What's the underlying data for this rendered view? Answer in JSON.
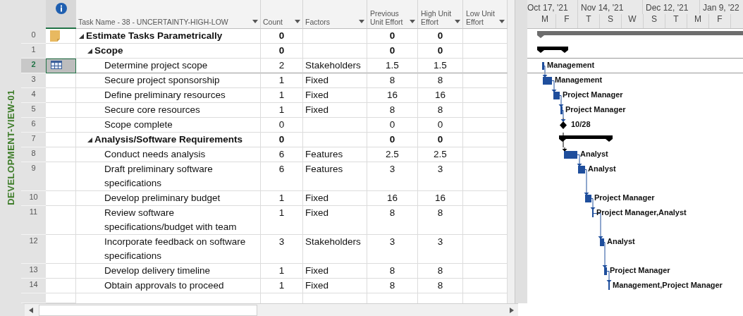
{
  "side_label": "DEVELOPMENT-VIEW-01",
  "columns": [
    {
      "label": "Task Name - 38 - UNCERTAINTY-HIGH-LOW"
    },
    {
      "label": "Count"
    },
    {
      "label": "Factors"
    },
    {
      "label": "Previous Unit Effort"
    },
    {
      "label": "High Unit Effort"
    },
    {
      "label": "Low Unit Effort"
    }
  ],
  "timescale": {
    "top": [
      "Oct 17, '21",
      "Nov 14, '21",
      "Dec 12, '21",
      "Jan 9, '22"
    ],
    "bottom": [
      "M",
      "F",
      "T",
      "S",
      "W",
      "S",
      "T",
      "M",
      "F"
    ]
  },
  "tasks": [
    {
      "row": "0",
      "name": "Estimate Tasks Parametrically",
      "kind": "project",
      "expanded": true,
      "selected": false,
      "indicator": {
        "kind": "note"
      },
      "count": "0",
      "prev": "0",
      "high": "0",
      "children": [
        {
          "row": "1",
          "name": "Scope",
          "kind": "summary",
          "expanded": true,
          "selected": false,
          "count": "0",
          "prev": "0",
          "high": "0",
          "children": [
            {
              "row": "2",
              "name": "Determine project scope",
              "kind": "task",
              "selected": true,
              "indicator": {
                "kind": "calendar"
              },
              "count": "2",
              "factors": "Stakeholders",
              "prev": "1.5",
              "high": "1.5",
              "label": "Management"
            },
            {
              "row": "3",
              "name": "Secure project sponsorship",
              "kind": "task",
              "selected": false,
              "count": "1",
              "factors": "Fixed",
              "prev": "8",
              "high": "8",
              "label": "Management"
            },
            {
              "row": "4",
              "name": "Define preliminary resources",
              "kind": "task",
              "selected": false,
              "count": "1",
              "factors": "Fixed",
              "prev": "16",
              "high": "16",
              "label": "Project Manager"
            },
            {
              "row": "5",
              "name": "Secure core resources",
              "kind": "task",
              "selected": false,
              "count": "1",
              "factors": "Fixed",
              "prev": "8",
              "high": "8",
              "label": "Project Manager"
            },
            {
              "row": "6",
              "name": "Scope complete",
              "kind": "milestone",
              "selected": false,
              "count": "0",
              "prev": "0",
              "high": "0",
              "label": "10/28"
            }
          ]
        },
        {
          "row": "7",
          "name": "Analysis/Software Requirements",
          "kind": "summary",
          "expanded": true,
          "selected": false,
          "count": "0",
          "prev": "0",
          "high": "0",
          "children": [
            {
              "row": "8",
              "name": "Conduct needs analysis",
              "kind": "task",
              "selected": false,
              "count": "6",
              "factors": "Features",
              "prev": "2.5",
              "high": "2.5",
              "label": "Analyst"
            },
            {
              "row": "9",
              "name": "Draft preliminary software specifications",
              "kind": "task",
              "selected": false,
              "count": "6",
              "factors": "Features",
              "prev": "3",
              "high": "3",
              "label": "Analyst"
            },
            {
              "row": "10",
              "name": "Develop preliminary budget",
              "kind": "task",
              "selected": false,
              "count": "1",
              "factors": "Fixed",
              "prev": "16",
              "high": "16",
              "label": "Project Manager"
            },
            {
              "row": "11",
              "name": "Review software specifications/budget with team",
              "kind": "task",
              "selected": false,
              "count": "1",
              "factors": "Fixed",
              "prev": "8",
              "high": "8",
              "label": "Project Manager,Analyst"
            },
            {
              "row": "12",
              "name": "Incorporate feedback on software specifications",
              "kind": "task",
              "selected": false,
              "count": "3",
              "factors": "Stakeholders",
              "prev": "3",
              "high": "3",
              "label": "Analyst"
            },
            {
              "row": "13",
              "name": "Develop delivery timeline",
              "kind": "task",
              "selected": false,
              "count": "1",
              "factors": "Fixed",
              "prev": "8",
              "high": "8",
              "label": "Project Manager"
            },
            {
              "row": "14",
              "name": "Obtain approvals to proceed",
              "kind": "task",
              "selected": false,
              "count": "1",
              "factors": "Fixed",
              "prev": "8",
              "high": "8",
              "label": "Management,Project Manager"
            }
          ]
        }
      ]
    }
  ]
}
